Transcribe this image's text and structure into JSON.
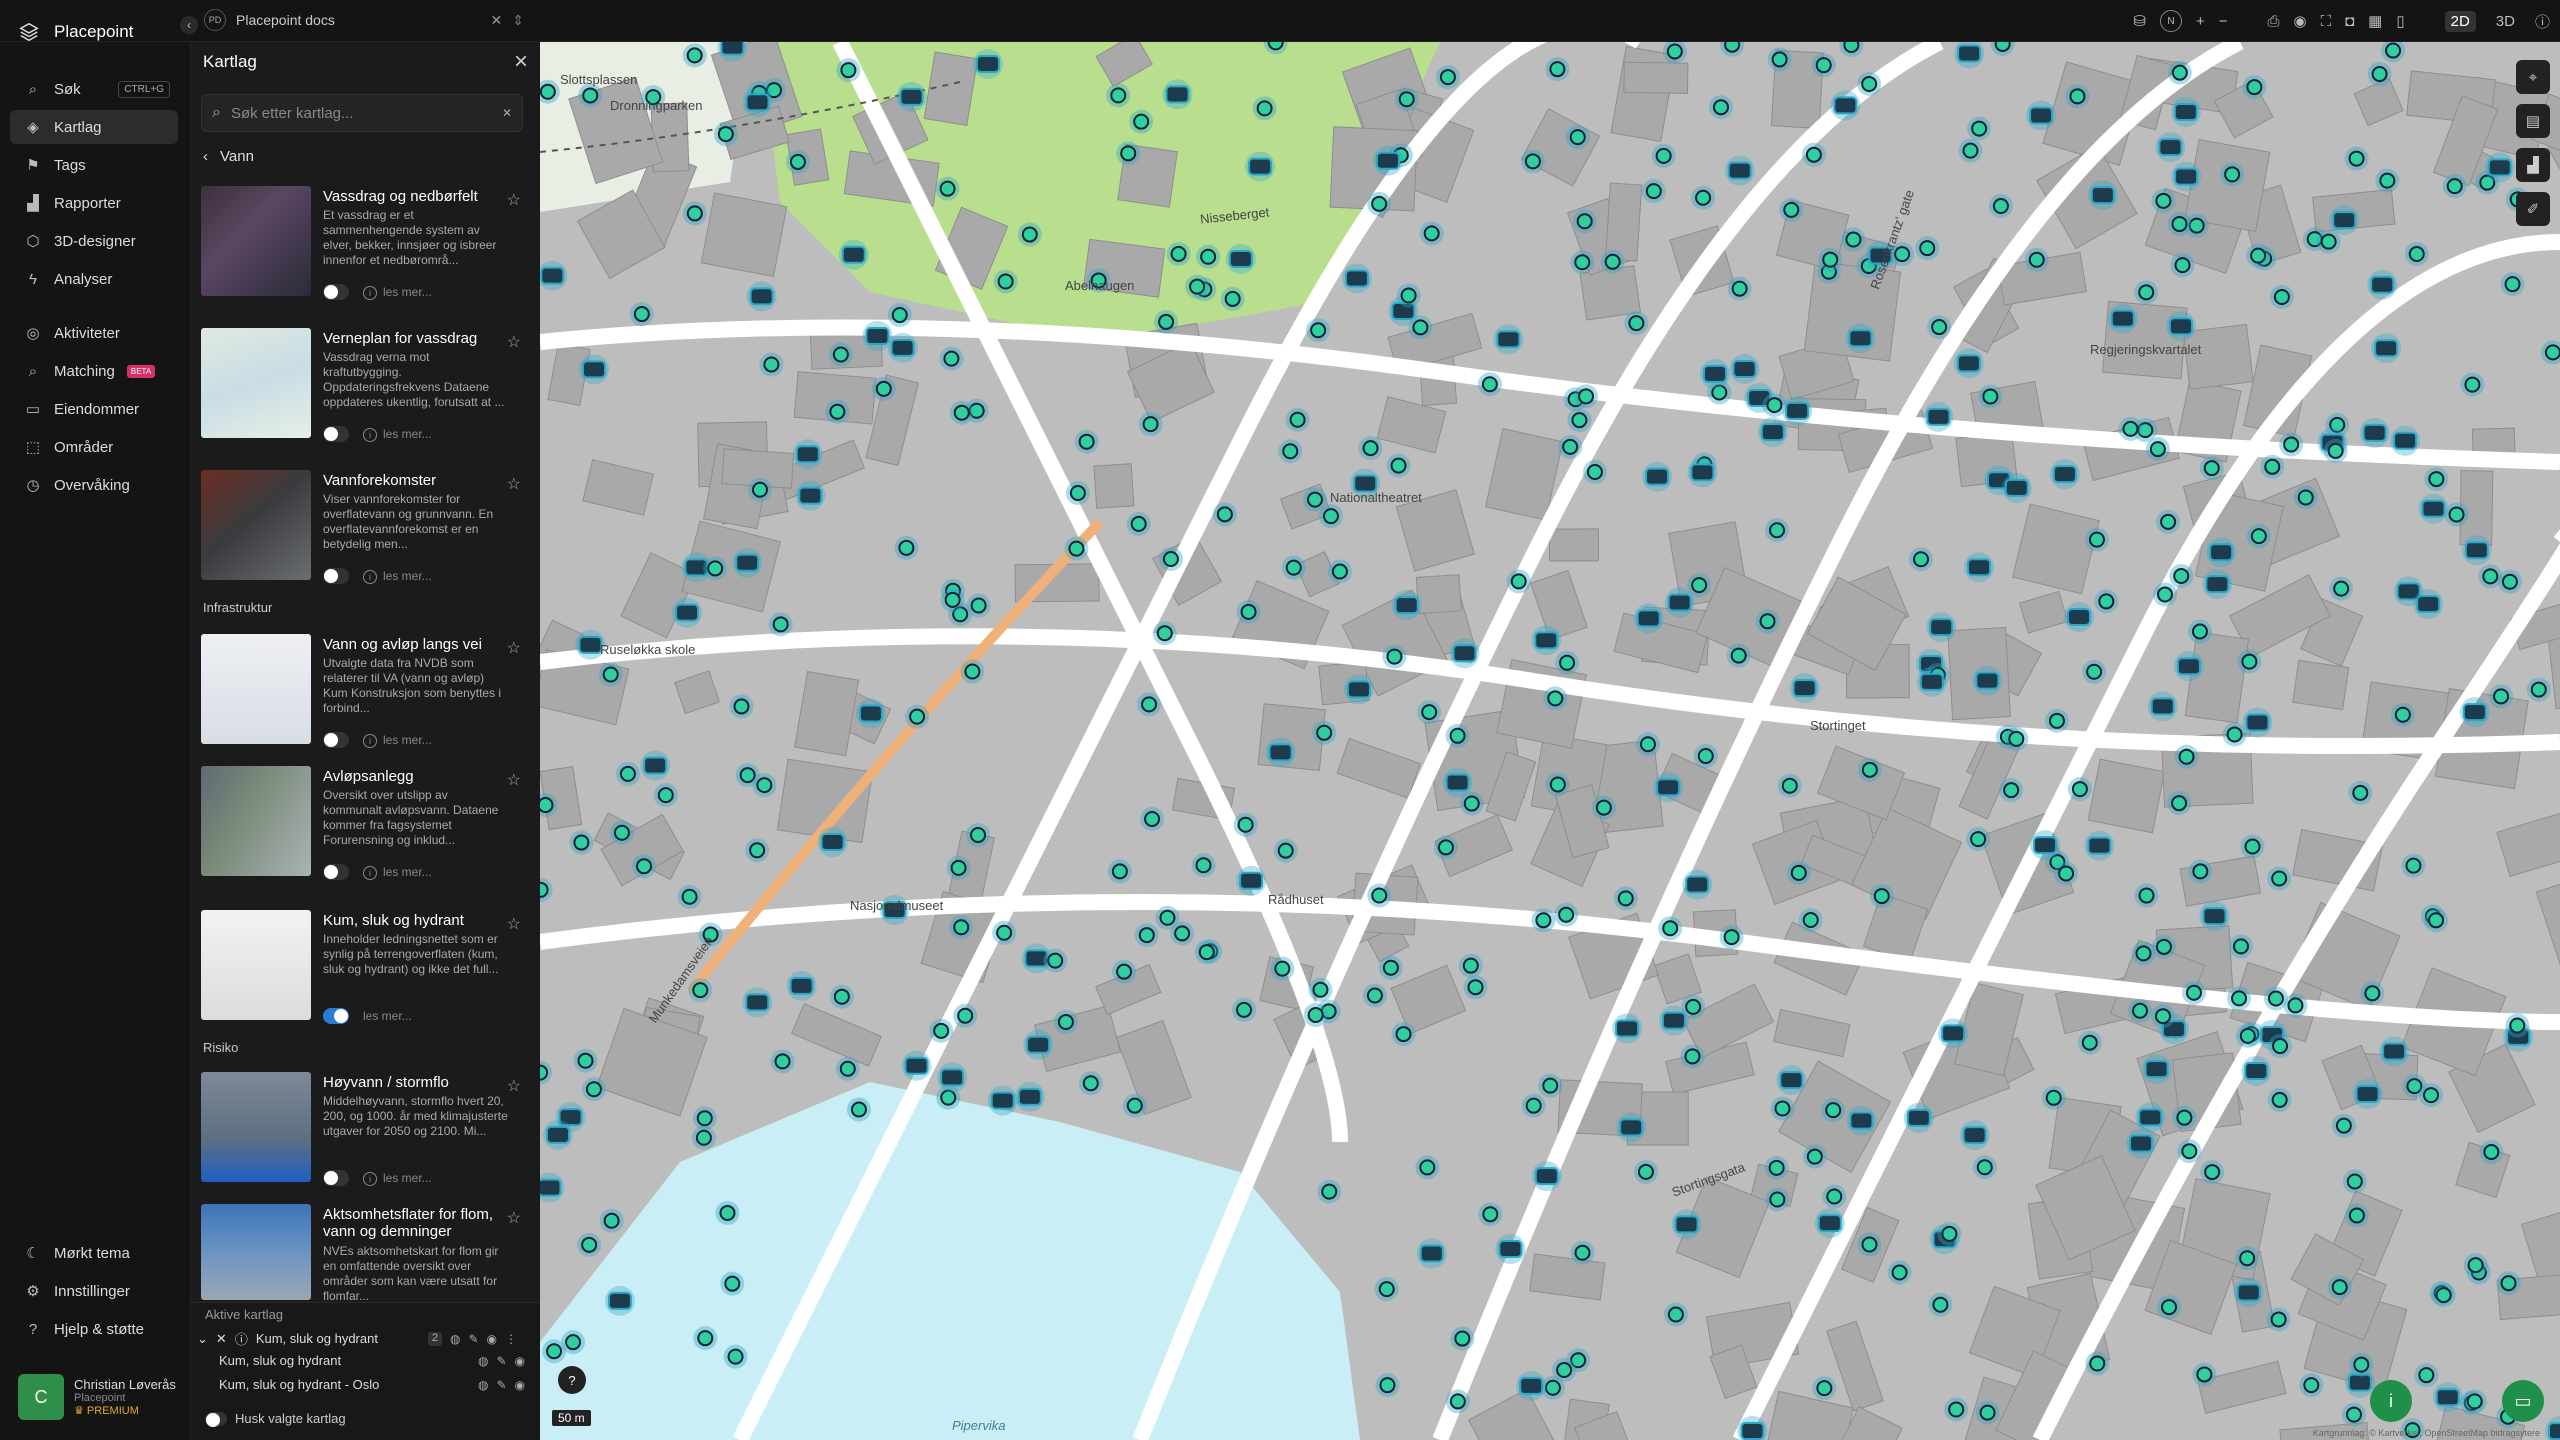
{
  "app": {
    "name": "Placepoint"
  },
  "tab": {
    "badge": "PD",
    "title": "Placepoint docs"
  },
  "toolbar": {
    "zoom_in": "+",
    "zoom_out": "−",
    "north": "N",
    "mode_2d": "2D",
    "mode_3d": "3D"
  },
  "nav": {
    "items": [
      {
        "label": "Søk",
        "icon": "search-icon",
        "shortcut": "CTRL+G"
      },
      {
        "label": "Kartlag",
        "icon": "layers-icon"
      },
      {
        "label": "Tags",
        "icon": "bookmark-icon"
      },
      {
        "label": "Rapporter",
        "icon": "chart-icon"
      },
      {
        "label": "3D-designer",
        "icon": "cube-icon"
      },
      {
        "label": "Analyser",
        "icon": "bolt-icon"
      },
      {
        "label": "Aktiviteter",
        "icon": "activity-icon"
      },
      {
        "label": "Matching",
        "icon": "match-icon",
        "badge": "BETA"
      },
      {
        "label": "Eiendommer",
        "icon": "property-icon"
      },
      {
        "label": "Områder",
        "icon": "area-icon"
      },
      {
        "label": "Overvåking",
        "icon": "monitor-icon"
      },
      {
        "label": "Mørkt tema",
        "icon": "moon-icon"
      },
      {
        "label": "Innstillinger",
        "icon": "gear-icon"
      },
      {
        "label": "Hjelp & støtte",
        "icon": "help-icon"
      }
    ]
  },
  "user": {
    "initial": "C",
    "name": "Christian Løverås",
    "org": "Placepoint",
    "plan": "PREMIUM"
  },
  "panel": {
    "title": "Kartlag",
    "search_placeholder": "Søk etter kartlag...",
    "back_label": "Vann",
    "read_more": "les mer...",
    "sections": {
      "infra": "Infrastruktur",
      "risk": "Risiko"
    },
    "cards": [
      {
        "title": "Vassdrag og nedbørfelt",
        "desc": "Et vassdrag er et sammenhengende system av elver, bekker, innsjøer og isbreer innenfor et nedbørområ...",
        "on": false
      },
      {
        "title": "Verneplan for vassdrag",
        "desc": "Vassdrag verna mot kraftutbygging. Oppdateringsfrekvens Dataene oppdateres ukentlig, forutsatt at ...",
        "on": false
      },
      {
        "title": "Vannforekomster",
        "desc": "Viser vannforekomster for overflatevann og grunnvann. En overflatevannforekomst er en betydelig men...",
        "on": false
      },
      {
        "title": "Vann og avløp langs vei",
        "desc": "Utvalgte data fra NVDB som relaterer til VA (vann og avløp) Kum Konstruksjon som benyttes i forbind...",
        "on": false
      },
      {
        "title": "Avløpsanlegg",
        "desc": "Oversikt over utslipp av kommunalt avløpsvann. Dataene kommer fra fagsystemet Forurensning og inklud...",
        "on": false
      },
      {
        "title": "Kum, sluk og hydrant",
        "desc": "Inneholder ledningsnettet som er synlig på terrengoverflaten (kum, sluk og hydrant) og ikke det full...",
        "on": true
      },
      {
        "title": "Høyvann / stormflo",
        "desc": "Middelhøyvann, stormflo hvert 20, 200, og 1000. år med klimajusterte utgaver for 2050 og 2100. Mi...",
        "on": false
      },
      {
        "title": "Aktsomhetsflater for flom, vann og demninger",
        "desc": "NVEs aktsomhetskart for flom gir en omfattende oversikt over områder som kan være utsatt for flomfar...",
        "on": false
      }
    ],
    "active": {
      "heading": "Aktive kartlag",
      "group": "Kum, sluk og hydrant",
      "group_count": "2",
      "rows": [
        "Kum, sluk og hydrant",
        "Kum, sluk og hydrant - Oslo"
      ],
      "remember": "Husk valgte kartlag"
    }
  },
  "map": {
    "scale": "50 m",
    "labels": [
      "Slottsplassen",
      "Dronningparken",
      "Nisseberget",
      "Abelhaugen",
      "Ruseløkka skole",
      "Nasjonalmuseet",
      "Rådhuset",
      "Stortinget",
      "Pipervika",
      "Regjeringskvartalet",
      "Nationaltheatret",
      "Munkedamsveien",
      "Stortingsgata",
      "Rosenkrantz' gate"
    ],
    "attribution": "Kartgrunnlag: © Kartverket, OpenStreetMap bidragsytere",
    "colors": {
      "marker_dot": "#2fd0a0",
      "marker_halo": "#2aa8c8",
      "marker_box": "#1e3a4d",
      "water": "#c9eef6",
      "park": "#b9df8e",
      "roads": "#ffffff",
      "blocks": "#a9a9a9"
    }
  }
}
